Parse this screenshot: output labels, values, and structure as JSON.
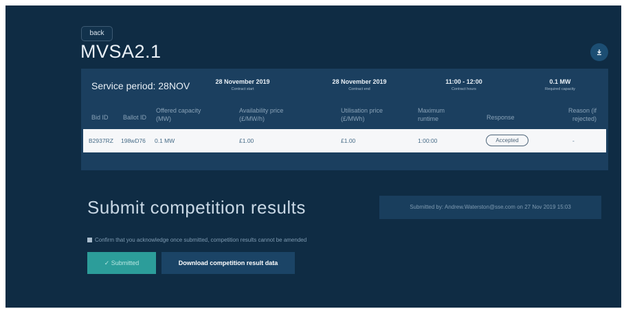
{
  "header": {
    "back_label": "back",
    "title": "MVSA2.1"
  },
  "service": {
    "period_label": "Service period: 28NOV",
    "meta": [
      {
        "value": "28 November 2019",
        "label": "Contract start"
      },
      {
        "value": "28 November 2019",
        "label": "Contract end"
      },
      {
        "value": "11:00 - 12:00",
        "label": "Contract hours"
      },
      {
        "value": "0.1 MW",
        "label": "Required capacity"
      }
    ]
  },
  "table": {
    "columns": [
      "Bid ID",
      "Ballot ID",
      "Offered capacity (MW)",
      "Availability price (£/MW/h)",
      "Utilisation price (£/MWh)",
      "Maximum runtime",
      "Response",
      "Reason (if rejected)"
    ],
    "rows": [
      {
        "bid_id": "B2937RZ",
        "ballot_id": "198wD76",
        "capacity": "0.1 MW",
        "availability_price": "£1.00",
        "utilisation_price": "£1.00",
        "max_runtime": "1:00:00",
        "response": "Accepted",
        "reason": "-"
      }
    ]
  },
  "submit": {
    "title": "Submit competition results",
    "submitted_by": "Submitted by: Andrew.Waterston@sse.com on 27 Nov 2019 15:03",
    "confirm_text": "Confirm that you acknowledge once submitted, competition results cannot be amended",
    "submitted_label": "✓ Submitted",
    "download_label": "Download competition result data"
  },
  "colors": {
    "background": "#0f2c44",
    "card": "#1b3f5f",
    "accent": "#2c9d9a"
  }
}
